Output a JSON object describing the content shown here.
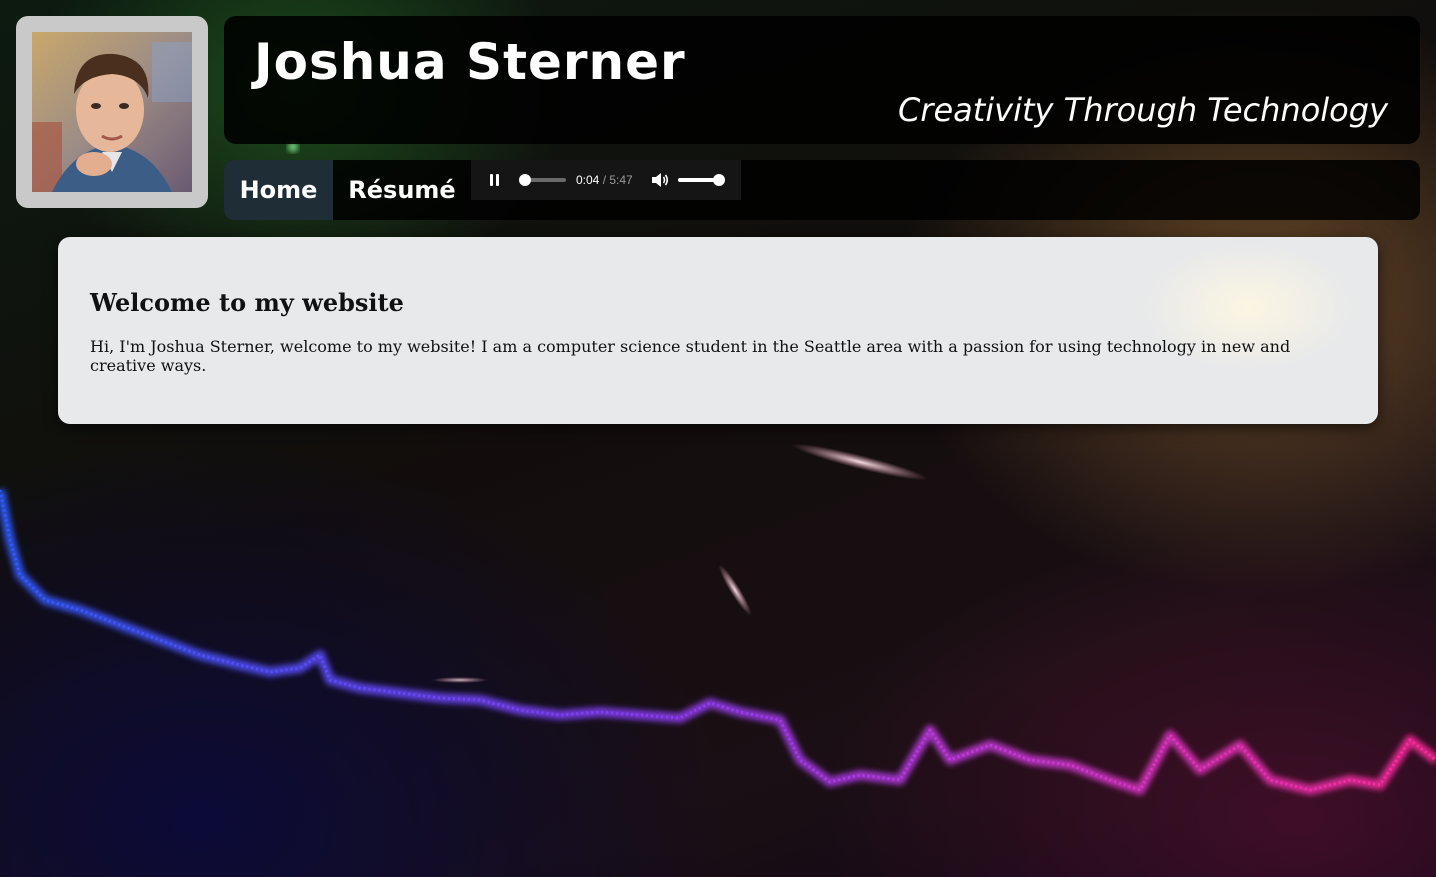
{
  "header": {
    "name": "Joshua Sterner",
    "tagline": "Creativity Through Technology"
  },
  "avatar": {
    "description_icon": "portrait-photo"
  },
  "nav": {
    "items": [
      {
        "label": "Home",
        "active": true
      },
      {
        "label": "Résumé",
        "active": false
      }
    ]
  },
  "audio_player": {
    "state": "playing",
    "current_time": "0:04",
    "separator": " / ",
    "duration": "5:47",
    "progress_fraction": 0.012,
    "volume_fraction": 1.0,
    "icons": {
      "play_pause": "pause-icon",
      "volume": "speaker-icon"
    }
  },
  "content": {
    "heading": "Welcome to my website",
    "paragraph": "Hi, I'm Joshua Sterner, welcome to my website! I am a computer science student in the Seattle area with a passion for using technology in new and creative ways."
  },
  "colors": {
    "nav_active_bg": "#1f2d36",
    "card_bg": "#e8e9ea",
    "avatar_frame": "#c9c9c9",
    "wave_start": "#2f5cff",
    "wave_mid": "#a13cf0",
    "wave_end": "#ff2a9a"
  }
}
